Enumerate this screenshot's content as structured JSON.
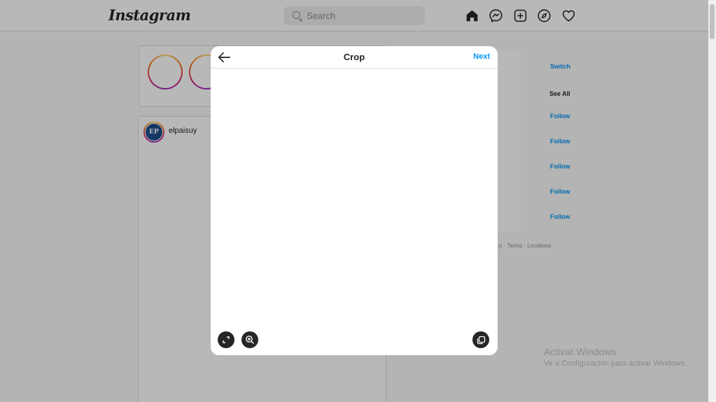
{
  "app": {
    "logo_text": "Instagram"
  },
  "search": {
    "placeholder": "Search",
    "value": ""
  },
  "feed": {
    "post_username": "elpaisuy",
    "post_avatar_initials": "EP"
  },
  "sidebar": {
    "switch_label": "Switch",
    "see_all_label": "See All",
    "follow_labels": [
      "Follow",
      "Follow",
      "Follow",
      "Follow",
      "Follow"
    ],
    "footer_text": "acy · Terms · Locations ·"
  },
  "modal": {
    "title": "Crop",
    "next_label": "Next"
  },
  "windows_watermark": {
    "title": "Activar Windows",
    "subtitle": "Ve a Configuración para activar Windows."
  },
  "colors": {
    "accent": "#0095f6",
    "overlay": "rgba(0,0,0,0.28)",
    "button_dark": "#262626"
  }
}
